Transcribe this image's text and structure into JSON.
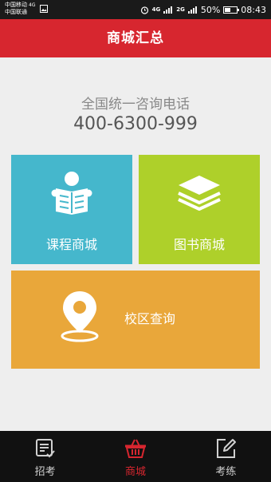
{
  "status_bar": {
    "carrier1": "中国移动",
    "carrier1_net": "4G",
    "carrier2": "中国联通",
    "sig1_tag": "4G",
    "sig2_tag": "2G",
    "battery_text": "50%",
    "battery_level": 0.5,
    "time": "08:43"
  },
  "header": {
    "title": "商城汇总"
  },
  "hotline": {
    "label": "全国统一咨询电话",
    "number": "400-6300-999"
  },
  "tiles": {
    "courses": {
      "label": "课程商城",
      "icon": "reading-icon",
      "color": "#45b7cc"
    },
    "books": {
      "label": "图书商城",
      "icon": "stacked-layers-icon",
      "color": "#aed02a"
    },
    "campus": {
      "label": "校区查询",
      "icon": "location-pin-icon",
      "color": "#e9a73a"
    }
  },
  "nav": {
    "items": [
      {
        "label": "招考",
        "icon": "document-check-icon"
      },
      {
        "label": "商城",
        "icon": "basket-icon",
        "active": true
      },
      {
        "label": "考练",
        "icon": "edit-icon"
      }
    ]
  },
  "colors": {
    "accent": "#d7262f"
  }
}
